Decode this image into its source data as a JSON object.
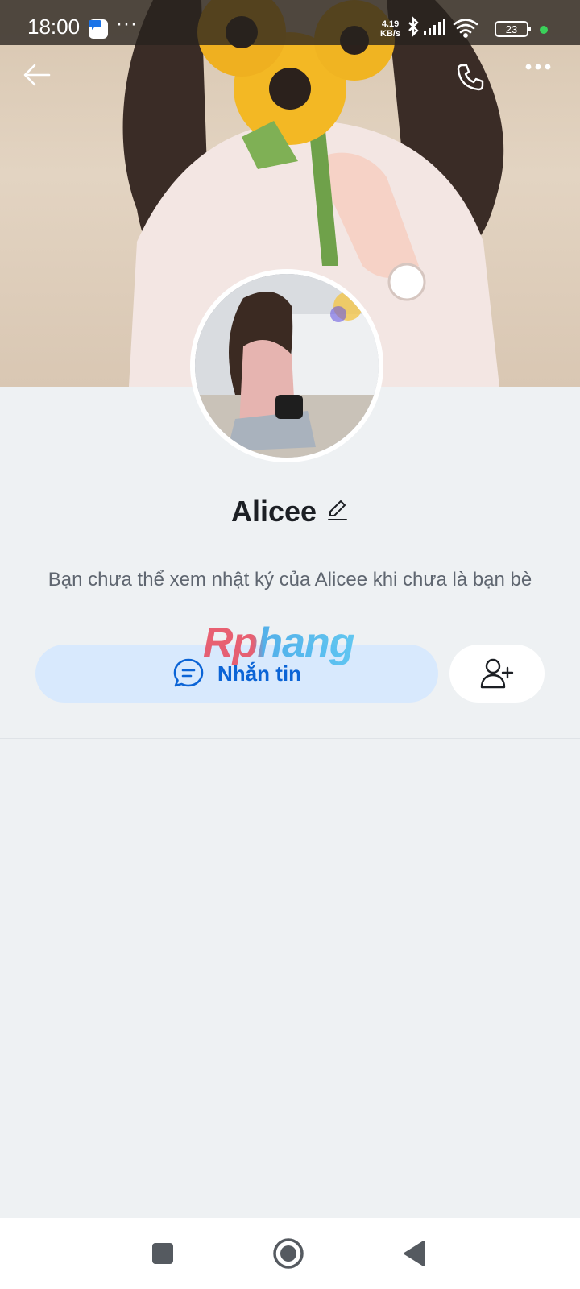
{
  "status_bar": {
    "time": "18:00",
    "more": "···",
    "net_speed_value": "4.19",
    "net_speed_unit": "KB/s",
    "battery": "23",
    "icons": [
      "message-app-icon",
      "bluetooth-icon",
      "signal-icon",
      "wifi-icon",
      "battery-icon"
    ]
  },
  "profile": {
    "name": "Alicee",
    "notice": "Bạn chưa thể xem nhật ký của Alicee khi chưa là bạn bè"
  },
  "actions": {
    "message_label": "Nhắn tin",
    "message_icon": "chat-bubble-icon",
    "add_friend_icon": "add-friend-icon"
  },
  "watermark": "Rphang",
  "colors": {
    "accent": "#0b64d6",
    "message_button_bg": "#d8e9fd",
    "page_bg": "#eef1f3"
  }
}
